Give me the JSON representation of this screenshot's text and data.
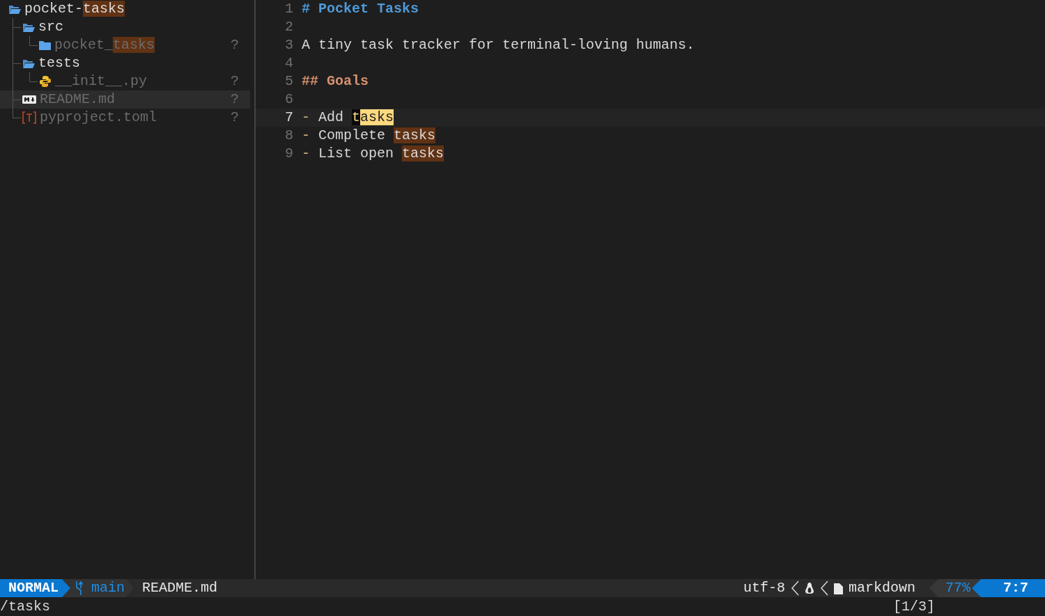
{
  "file_tree": {
    "root": {
      "kind": "folder",
      "expanded": true,
      "selected": false,
      "dimmed": false,
      "name": [
        {
          "text": "pocket-",
          "match": false
        },
        {
          "text": "tasks",
          "match": true
        }
      ],
      "children": [
        {
          "kind": "folder",
          "expanded": true,
          "selected": false,
          "dimmed": false,
          "name": [
            {
              "text": "src",
              "match": false
            }
          ],
          "children": [
            {
              "kind": "folder",
              "expanded": false,
              "selected": false,
              "dimmed": true,
              "status": "?",
              "name": [
                {
                  "text": "pocket_",
                  "match": false
                },
                {
                  "text": "tasks",
                  "match": true
                }
              ]
            }
          ]
        },
        {
          "kind": "folder",
          "expanded": true,
          "selected": false,
          "dimmed": false,
          "name": [
            {
              "text": "tests",
              "match": false
            }
          ],
          "children": [
            {
              "kind": "python",
              "selected": false,
              "dimmed": true,
              "status": "?",
              "name": [
                {
                  "text": "__init__.py",
                  "match": false
                }
              ]
            }
          ]
        },
        {
          "kind": "markdown",
          "selected": true,
          "dimmed": true,
          "status": "?",
          "name": [
            {
              "text": "README.md",
              "match": false
            }
          ]
        },
        {
          "kind": "toml",
          "selected": false,
          "dimmed": true,
          "status": "?",
          "name": [
            {
              "text": "pyproject.toml",
              "match": false
            }
          ]
        }
      ]
    }
  },
  "editor": {
    "lines": [
      {
        "number": "1",
        "current": false,
        "segments": [
          {
            "text": "# Pocket Tasks",
            "kind": "heading1"
          }
        ]
      },
      {
        "number": "2",
        "current": false
      },
      {
        "number": "3",
        "current": false,
        "segments": [
          {
            "text": "A tiny task tracker for terminal-loving humans.",
            "kind": "plain"
          }
        ]
      },
      {
        "number": "4",
        "current": false
      },
      {
        "number": "5",
        "current": false,
        "segments": [
          {
            "text": "## Goals",
            "kind": "heading2"
          }
        ]
      },
      {
        "number": "6",
        "current": false
      },
      {
        "number": "7",
        "current": true,
        "segments": [
          {
            "text": "-",
            "kind": "bullet"
          },
          {
            "text": " Add ",
            "kind": "plain"
          },
          {
            "text": "t",
            "kind": "cursor"
          },
          {
            "text": "asks",
            "kind": "current_match"
          }
        ]
      },
      {
        "number": "8",
        "current": false,
        "segments": [
          {
            "text": "-",
            "kind": "bullet"
          },
          {
            "text": " Complete ",
            "kind": "plain"
          },
          {
            "text": "tasks",
            "kind": "match"
          }
        ]
      },
      {
        "number": "9",
        "current": false,
        "segments": [
          {
            "text": "-",
            "kind": "bullet"
          },
          {
            "text": " List open ",
            "kind": "plain"
          },
          {
            "text": "tasks",
            "kind": "match"
          }
        ]
      }
    ]
  },
  "status_bar": {
    "mode": "NORMAL",
    "branch": "main",
    "file": "README.md",
    "encoding": "utf-8",
    "filetype": "markdown",
    "progress": "77%",
    "position": "7:7"
  },
  "command_line": {
    "text": "/tasks",
    "search_count": "[1/3]"
  }
}
